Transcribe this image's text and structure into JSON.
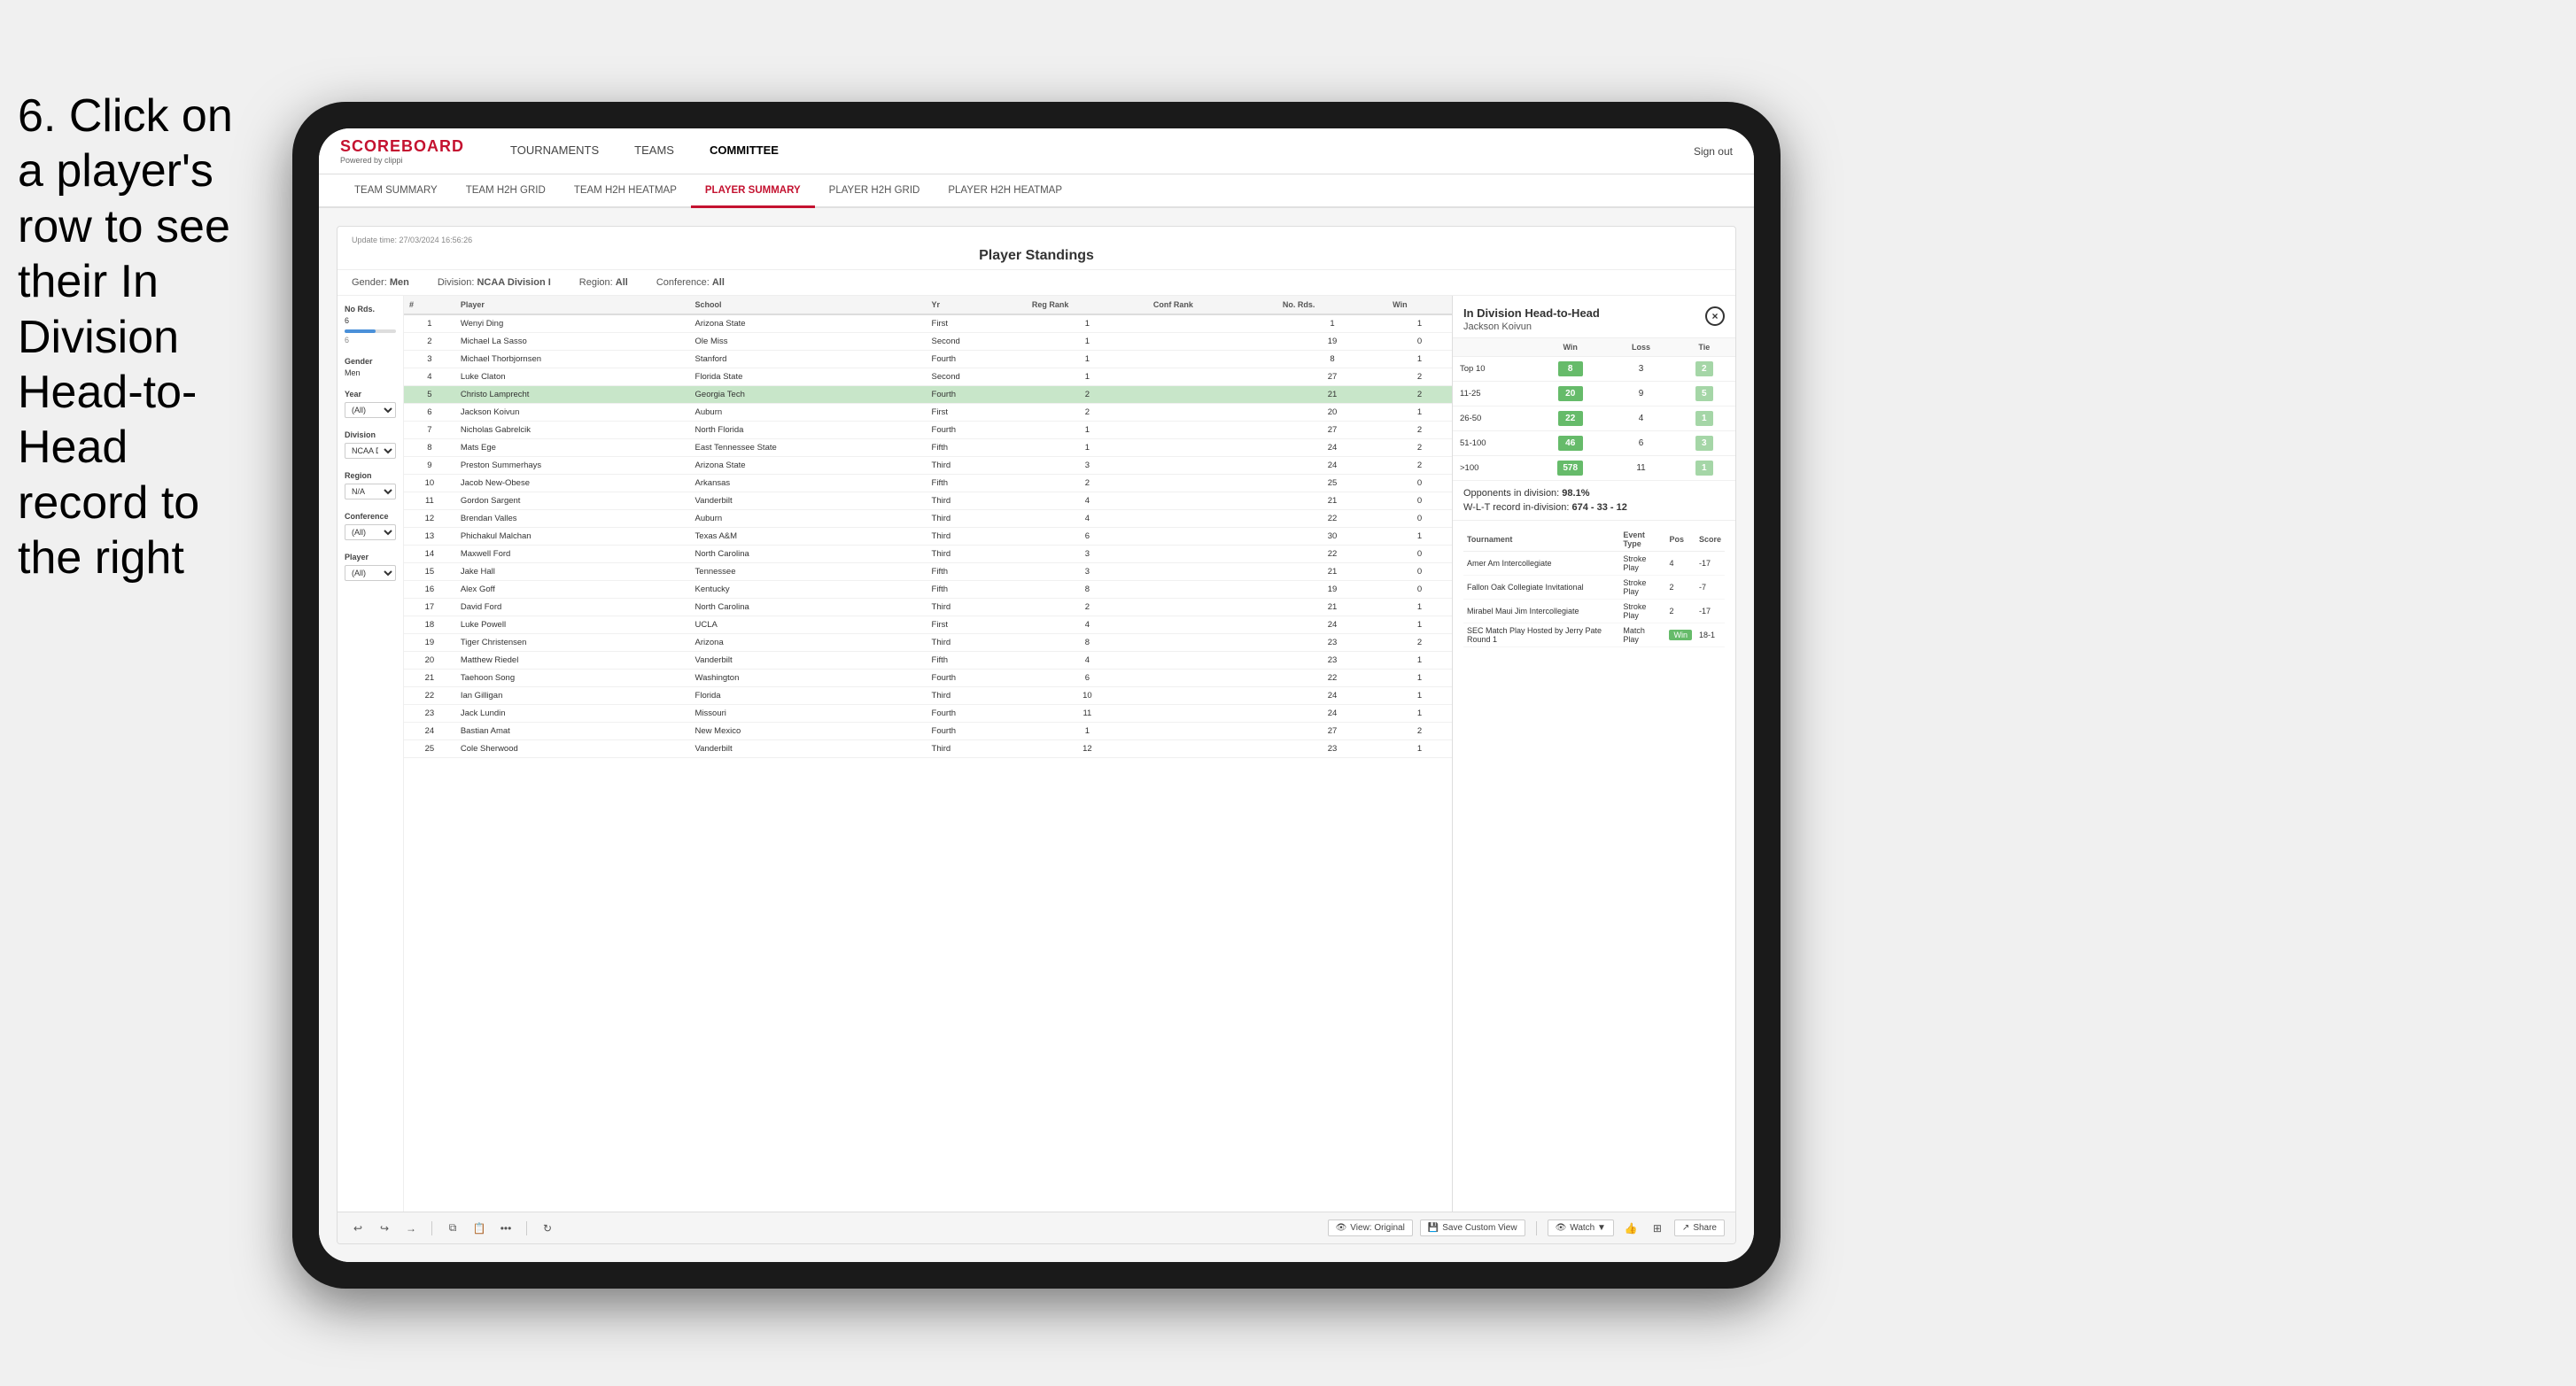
{
  "instruction": {
    "text": "6. Click on a player's row to see their In Division Head-to-Head record to the right"
  },
  "app": {
    "logo": "SCOREBOARD",
    "logo_sub": "Powered by clippi",
    "sign_out": "Sign out",
    "nav": {
      "items": [
        {
          "label": "TOURNAMENTS",
          "active": false
        },
        {
          "label": "TEAMS",
          "active": false
        },
        {
          "label": "COMMITTEE",
          "active": true
        }
      ]
    },
    "sub_nav": {
      "items": [
        {
          "label": "TEAM SUMMARY",
          "active": false
        },
        {
          "label": "TEAM H2H GRID",
          "active": false
        },
        {
          "label": "TEAM H2H HEATMAP",
          "active": false
        },
        {
          "label": "PLAYER SUMMARY",
          "active": true
        },
        {
          "label": "PLAYER H2H GRID",
          "active": false
        },
        {
          "label": "PLAYER H2H HEATMAP",
          "active": false
        }
      ]
    }
  },
  "dashboard": {
    "update_time_label": "Update time:",
    "update_time": "27/03/2024 16:56:26",
    "title": "Player Standings",
    "filters": {
      "gender_label": "Gender:",
      "gender_value": "Men",
      "division_label": "Division:",
      "division_value": "NCAA Division I",
      "region_label": "Region:",
      "region_value": "All",
      "conference_label": "Conference:",
      "conference_value": "All"
    }
  },
  "left_filters": {
    "no_rds": {
      "label": "No Rds.",
      "value": "6",
      "sub_value": "6"
    },
    "gender_label": "Gender",
    "gender_value": "Men",
    "year_label": "Year",
    "year_value": "(All)",
    "division_label": "Division",
    "division_value": "NCAA Division I",
    "region_label": "Region",
    "region_value": "N/A",
    "conference_label": "Conference",
    "conference_value": "(All)",
    "player_label": "Player",
    "player_value": "(All)"
  },
  "table": {
    "headers": [
      "#",
      "Player",
      "School",
      "Yr",
      "Reg Rank",
      "Conf Rank",
      "No. Rds.",
      "Win"
    ],
    "selected_row": 5,
    "rows": [
      {
        "num": 1,
        "player": "Wenyi Ding",
        "school": "Arizona State",
        "yr": "First",
        "reg_rank": 1,
        "conf_rank": "",
        "no_rds": 1,
        "win": 1
      },
      {
        "num": 2,
        "player": "Michael La Sasso",
        "school": "Ole Miss",
        "yr": "Second",
        "reg_rank": 1,
        "conf_rank": "",
        "no_rds": 19,
        "win": 0
      },
      {
        "num": 3,
        "player": "Michael Thorbjornsen",
        "school": "Stanford",
        "yr": "Fourth",
        "reg_rank": 1,
        "conf_rank": "",
        "no_rds": 8,
        "win": 1
      },
      {
        "num": 4,
        "player": "Luke Claton",
        "school": "Florida State",
        "yr": "Second",
        "reg_rank": 1,
        "conf_rank": "",
        "no_rds": 27,
        "win": 2
      },
      {
        "num": 5,
        "player": "Christo Lamprecht",
        "school": "Georgia Tech",
        "yr": "Fourth",
        "reg_rank": 2,
        "conf_rank": "",
        "no_rds": 21,
        "win": 2
      },
      {
        "num": 6,
        "player": "Jackson Koivun",
        "school": "Auburn",
        "yr": "First",
        "reg_rank": 2,
        "conf_rank": "",
        "no_rds": 20,
        "win": 1
      },
      {
        "num": 7,
        "player": "Nicholas Gabrelcik",
        "school": "North Florida",
        "yr": "Fourth",
        "reg_rank": 1,
        "conf_rank": "",
        "no_rds": 27,
        "win": 2
      },
      {
        "num": 8,
        "player": "Mats Ege",
        "school": "East Tennessee State",
        "yr": "Fifth",
        "reg_rank": 1,
        "conf_rank": "",
        "no_rds": 24,
        "win": 2
      },
      {
        "num": 9,
        "player": "Preston Summerhays",
        "school": "Arizona State",
        "yr": "Third",
        "reg_rank": 3,
        "conf_rank": "",
        "no_rds": 24,
        "win": 2
      },
      {
        "num": 10,
        "player": "Jacob New-Obese",
        "school": "Arkansas",
        "yr": "Fifth",
        "reg_rank": 2,
        "conf_rank": "",
        "no_rds": 25,
        "win": 0
      },
      {
        "num": 11,
        "player": "Gordon Sargent",
        "school": "Vanderbilt",
        "yr": "Third",
        "reg_rank": 4,
        "conf_rank": "",
        "no_rds": 21,
        "win": 0
      },
      {
        "num": 12,
        "player": "Brendan Valles",
        "school": "Auburn",
        "yr": "Third",
        "reg_rank": 4,
        "conf_rank": "",
        "no_rds": 22,
        "win": 0
      },
      {
        "num": 13,
        "player": "Phichakul Malchan",
        "school": "Texas A&M",
        "yr": "Third",
        "reg_rank": 6,
        "conf_rank": "",
        "no_rds": 30,
        "win": 1
      },
      {
        "num": 14,
        "player": "Maxwell Ford",
        "school": "North Carolina",
        "yr": "Third",
        "reg_rank": 3,
        "conf_rank": "",
        "no_rds": 22,
        "win": 0
      },
      {
        "num": 15,
        "player": "Jake Hall",
        "school": "Tennessee",
        "yr": "Fifth",
        "reg_rank": 3,
        "conf_rank": "",
        "no_rds": 21,
        "win": 0
      },
      {
        "num": 16,
        "player": "Alex Goff",
        "school": "Kentucky",
        "yr": "Fifth",
        "reg_rank": 8,
        "conf_rank": "",
        "no_rds": 19,
        "win": 0
      },
      {
        "num": 17,
        "player": "David Ford",
        "school": "North Carolina",
        "yr": "Third",
        "reg_rank": 2,
        "conf_rank": "",
        "no_rds": 21,
        "win": 1
      },
      {
        "num": 18,
        "player": "Luke Powell",
        "school": "UCLA",
        "yr": "First",
        "reg_rank": 4,
        "conf_rank": "",
        "no_rds": 24,
        "win": 1
      },
      {
        "num": 19,
        "player": "Tiger Christensen",
        "school": "Arizona",
        "yr": "Third",
        "reg_rank": 8,
        "conf_rank": "",
        "no_rds": 23,
        "win": 2
      },
      {
        "num": 20,
        "player": "Matthew Riedel",
        "school": "Vanderbilt",
        "yr": "Fifth",
        "reg_rank": 4,
        "conf_rank": "",
        "no_rds": 23,
        "win": 1
      },
      {
        "num": 21,
        "player": "Taehoon Song",
        "school": "Washington",
        "yr": "Fourth",
        "reg_rank": 6,
        "conf_rank": "",
        "no_rds": 22,
        "win": 1
      },
      {
        "num": 22,
        "player": "Ian Gilligan",
        "school": "Florida",
        "yr": "Third",
        "reg_rank": 10,
        "conf_rank": "",
        "no_rds": 24,
        "win": 1
      },
      {
        "num": 23,
        "player": "Jack Lundin",
        "school": "Missouri",
        "yr": "Fourth",
        "reg_rank": 11,
        "conf_rank": "",
        "no_rds": 24,
        "win": 1
      },
      {
        "num": 24,
        "player": "Bastian Amat",
        "school": "New Mexico",
        "yr": "Fourth",
        "reg_rank": 1,
        "conf_rank": "",
        "no_rds": 27,
        "win": 2
      },
      {
        "num": 25,
        "player": "Cole Sherwood",
        "school": "Vanderbilt",
        "yr": "Third",
        "reg_rank": 12,
        "conf_rank": "",
        "no_rds": 23,
        "win": 1
      }
    ]
  },
  "h2h_panel": {
    "title": "In Division Head-to-Head",
    "player": "Jackson Koivun",
    "close_btn": "×",
    "stats_headers": [
      "",
      "Win",
      "Loss",
      "Tie"
    ],
    "stats_rows": [
      {
        "range": "Top 10",
        "win": 8,
        "loss": 3,
        "tie": 2
      },
      {
        "range": "11-25",
        "win": 20,
        "loss": 9,
        "tie": 5
      },
      {
        "range": "26-50",
        "win": 22,
        "loss": 4,
        "tie": 1
      },
      {
        "range": "51-100",
        "win": 46,
        "loss": 6,
        "tie": 3
      },
      {
        "range": ">100",
        "win": 578,
        "loss": 11,
        "tie": 1
      }
    ],
    "opponents_label": "Opponents in division:",
    "wl_label": "W-L-T record in-division:",
    "opponents_pct": "98.1%",
    "wl_record": "674 - 33 - 12",
    "tournaments": {
      "headers": [
        "Tournament",
        "Event Type",
        "Pos",
        "Score"
      ],
      "rows": [
        {
          "tournament": "Amer Am Intercollegiate",
          "event_type": "Stroke Play",
          "pos": 4,
          "score": "-17"
        },
        {
          "tournament": "Fallon Oak Collegiate Invitational",
          "event_type": "Stroke Play",
          "pos": 2,
          "score": "-7"
        },
        {
          "tournament": "Mirabel Maui Jim Intercollegiate",
          "event_type": "Stroke Play",
          "pos": 2,
          "score": "-17"
        },
        {
          "tournament": "SEC Match Play Hosted by Jerry Pate Round 1",
          "event_type": "Match Play",
          "pos": "Win",
          "score": "18-1"
        }
      ]
    }
  },
  "toolbar": {
    "view_original": "View: Original",
    "save_custom": "Save Custom View",
    "watch": "Watch ▼",
    "share": "Share"
  }
}
